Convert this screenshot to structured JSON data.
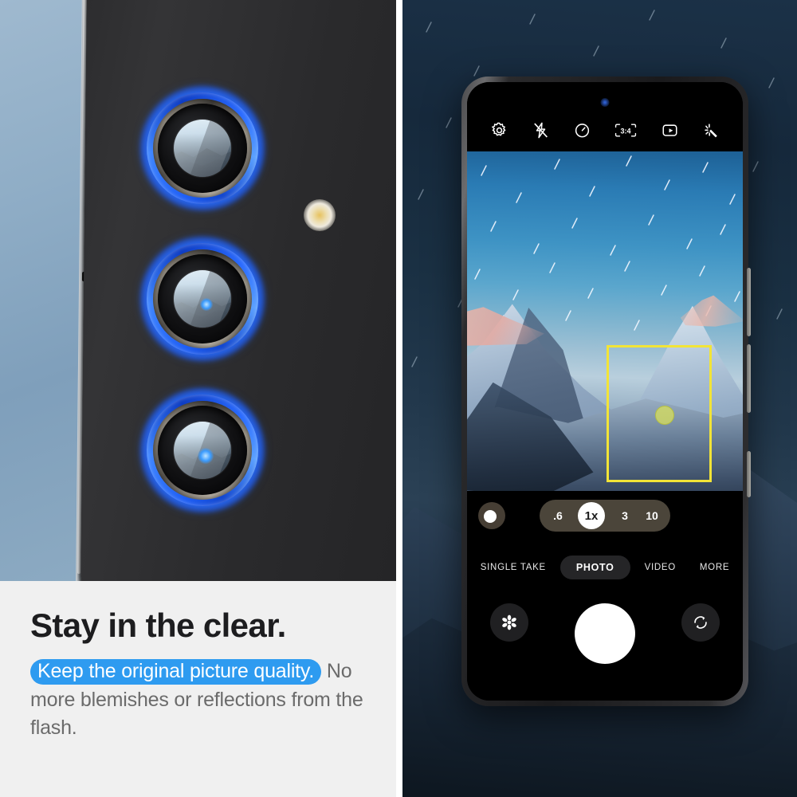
{
  "marketing": {
    "headline": "Stay in the clear.",
    "highlight_text": "Keep the original picture quality.",
    "body_text": "No more blemishes or reflections from the flash.",
    "highlight_color": "#2e9bf0",
    "headline_color": "#1d1d1f",
    "body_color": "#6b6b6b"
  },
  "left_photo": {
    "caption_semantics": "close-up of phone camera module with blue lens protector rings",
    "lens_count": 3,
    "ring_color": "#2a6bff",
    "flash_label": "LED flash"
  },
  "camera_app": {
    "top_bar": [
      {
        "name": "settings-icon",
        "label": "Settings"
      },
      {
        "name": "flash-off-icon",
        "label": "Flash off"
      },
      {
        "name": "timer-icon",
        "label": "Timer"
      },
      {
        "name": "aspect-ratio-icon",
        "label": "3:4"
      },
      {
        "name": "motion-photo-icon",
        "label": "Motion photo"
      },
      {
        "name": "filters-icon",
        "label": "Filters"
      }
    ],
    "aspect_ratio_value": "3:4",
    "zoom": {
      "options": [
        ".6",
        "1x",
        "3",
        "10"
      ],
      "selected": "1x"
    },
    "brightness_knob_label": "Brightness",
    "modes": [
      {
        "label": "SINGLE TAKE",
        "active": false
      },
      {
        "label": "PHOTO",
        "active": true
      },
      {
        "label": "VIDEO",
        "active": false
      },
      {
        "label": "MORE",
        "active": false
      }
    ],
    "bottom_bar": {
      "gallery_label": "Gallery",
      "shutter_label": "Shutter",
      "flip_label": "Switch camera"
    },
    "focus_box": {
      "color": "#f2e437",
      "exposure_dot_color": "#d6de5e"
    },
    "viewfinder_scene": "Snowy mountain peaks under a starry night sky"
  }
}
